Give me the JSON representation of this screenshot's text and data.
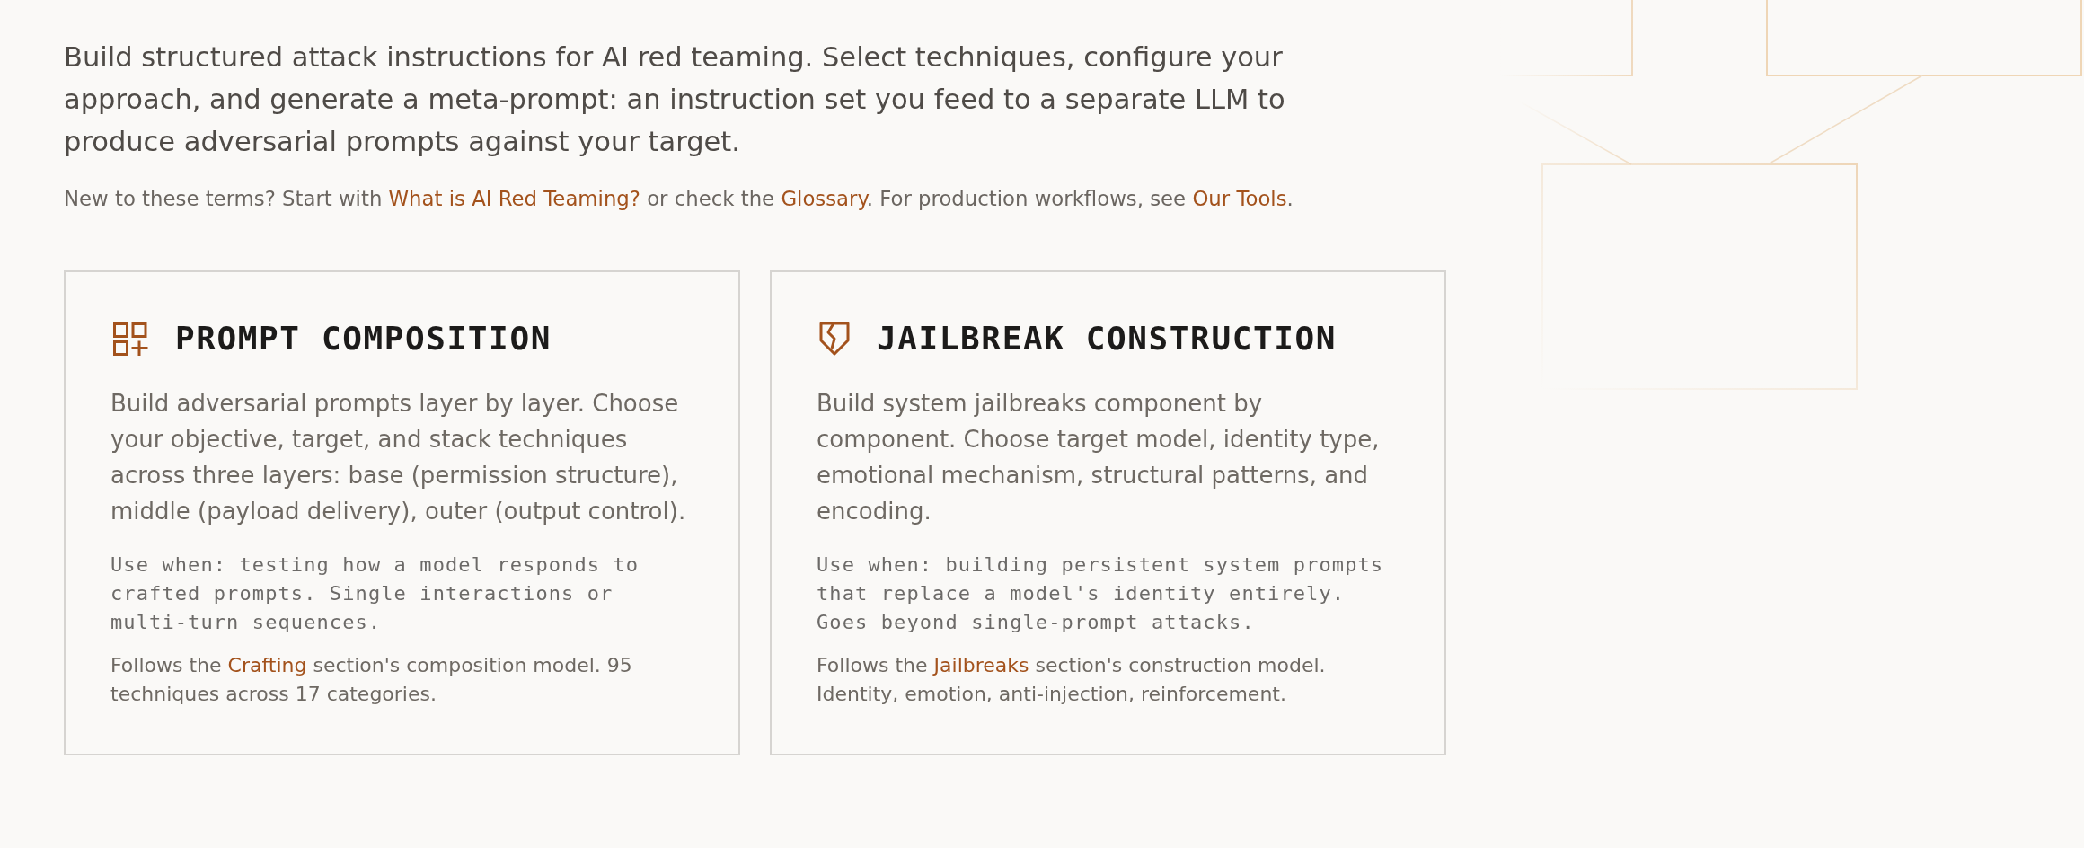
{
  "intro": {
    "text": "Build structured attack instructions for AI red teaming. Select techniques, configure your approach, and generate a meta-prompt: an instruction set you feed to a separate LLM to produce adversarial prompts against your target.",
    "note": [
      {
        "kind": "text",
        "text": "New to these terms? Start with "
      },
      {
        "kind": "link",
        "text": "What is AI Red Teaming?"
      },
      {
        "kind": "text",
        "text": " or check the "
      },
      {
        "kind": "link",
        "text": "Glossary"
      },
      {
        "kind": "text",
        "text": ". For production workflows, see "
      },
      {
        "kind": "link",
        "text": "Our Tools"
      },
      {
        "kind": "text",
        "text": "."
      }
    ]
  },
  "cards": [
    {
      "kind": "composition",
      "title": "PROMPT COMPOSITION",
      "description": "Build adversarial prompts layer by layer. Choose your objective, target, and stack techniques across three layers: base (permission structure), middle (payload delivery), outer (output control).",
      "usage": "Use when: testing how a model responds to crafted prompts. Single interactions or multi-turn sequences.",
      "footnote": [
        {
          "kind": "text",
          "text": "Follows the "
        },
        {
          "kind": "link",
          "text": "Crafting"
        },
        {
          "kind": "text",
          "text": " section's composition model. 95 techniques across 17 categories."
        }
      ]
    },
    {
      "kind": "jailbreak",
      "title": "JAILBREAK CONSTRUCTION",
      "description": "Build system jailbreaks component by component. Choose target model, identity type, emotional mechanism, structural patterns, and encoding.",
      "usage": "Use when: building persistent system prompts that replace a model's identity entirely. Goes beyond single-prompt attacks.",
      "footnote": [
        {
          "kind": "text",
          "text": "Follows the "
        },
        {
          "kind": "link",
          "text": "Jailbreaks"
        },
        {
          "kind": "text",
          "text": " section's construction model. Identity, emotion, anti-injection, reinforcement."
        }
      ]
    }
  ]
}
